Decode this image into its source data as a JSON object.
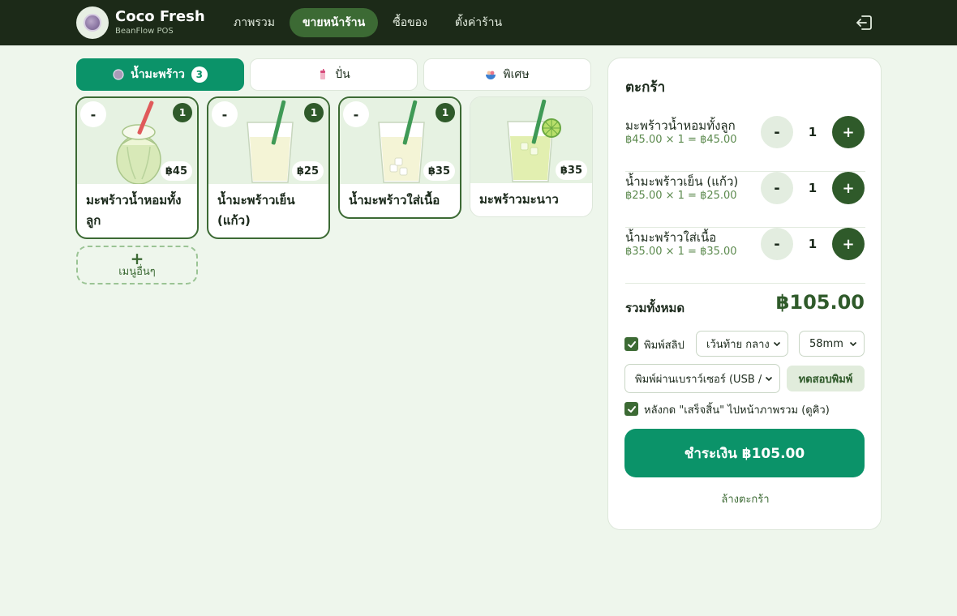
{
  "app": {
    "name": "Coco Fresh",
    "subtitle": "BeanFlow POS"
  },
  "nav": {
    "items": [
      {
        "label": "ภาพรวม",
        "active": false
      },
      {
        "label": "ขายหน้าร้าน",
        "active": true
      },
      {
        "label": "ซื้อของ",
        "active": false
      },
      {
        "label": "ตั้งค่าร้าน",
        "active": false
      }
    ],
    "logout_icon": "logout-icon"
  },
  "categories": [
    {
      "label": "น้ำมะพร้าว",
      "count": "3",
      "icon": "coconut-icon",
      "active": true
    },
    {
      "label": "ปั่น",
      "icon": "smoothie-icon",
      "active": false
    },
    {
      "label": "พิเศษ",
      "icon": "dessert-bowl-icon",
      "active": false
    }
  ],
  "products": [
    {
      "name": "มะพร้าวน้ำหอมทั้งลูก",
      "price": "฿45",
      "qty": "1",
      "minus": "-",
      "selected": true,
      "art": "whole-coconut"
    },
    {
      "name": "น้ำมะพร้าวเย็น (แก้ว)",
      "price": "฿25",
      "qty": "1",
      "minus": "-",
      "selected": true,
      "art": "glass"
    },
    {
      "name": "น้ำมะพร้าวใส่เนื้อ",
      "price": "฿35",
      "qty": "1",
      "minus": "-",
      "selected": true,
      "art": "glass-meat"
    },
    {
      "name": "มะพร้าวมะนาว",
      "price": "฿35",
      "selected": false,
      "art": "glass-lime"
    }
  ],
  "add_more": {
    "plus": "+",
    "label": "เมนูอื่นๆ"
  },
  "cart": {
    "title": "ตะกร้า",
    "items": [
      {
        "name": "มะพร้าวน้ำหอมทั้งลูก",
        "detail": "฿45.00 × 1 = ฿45.00",
        "qty": "1",
        "minus": "-",
        "plus": "+"
      },
      {
        "name": "น้ำมะพร้าวเย็น (แก้ว)",
        "detail": "฿25.00 × 1 = ฿25.00",
        "qty": "1",
        "minus": "-",
        "plus": "+"
      },
      {
        "name": "น้ำมะพร้าวใส่เนื้อ",
        "detail": "฿35.00 × 1 = ฿35.00",
        "qty": "1",
        "minus": "-",
        "plus": "+"
      }
    ],
    "total_label": "รวมทั้งหมด",
    "total_value": "฿105.00",
    "print_slip_label": "พิมพ์สลิป",
    "print_slip_checked": true,
    "margin_select": "เว้นท้าย กลาง",
    "paper_select": "58mm",
    "printer_select": "พิมพ์ผ่านเบราว์เซอร์ (USB /",
    "test_print": "ทดสอบพิมพ์",
    "goto_overview_label": "หลังกด \"เสร็จสิ้น\" ไปหน้าภาพรวม (ดูคิว)",
    "goto_overview_checked": true,
    "pay_button": "ชำระเงิน ฿105.00",
    "clear_link": "ล้างตะกร้า"
  },
  "colors": {
    "topbar": "#1c2a18",
    "accent": "#0b9369",
    "dark_green": "#2f5a2a",
    "background": "#eef6ec"
  }
}
